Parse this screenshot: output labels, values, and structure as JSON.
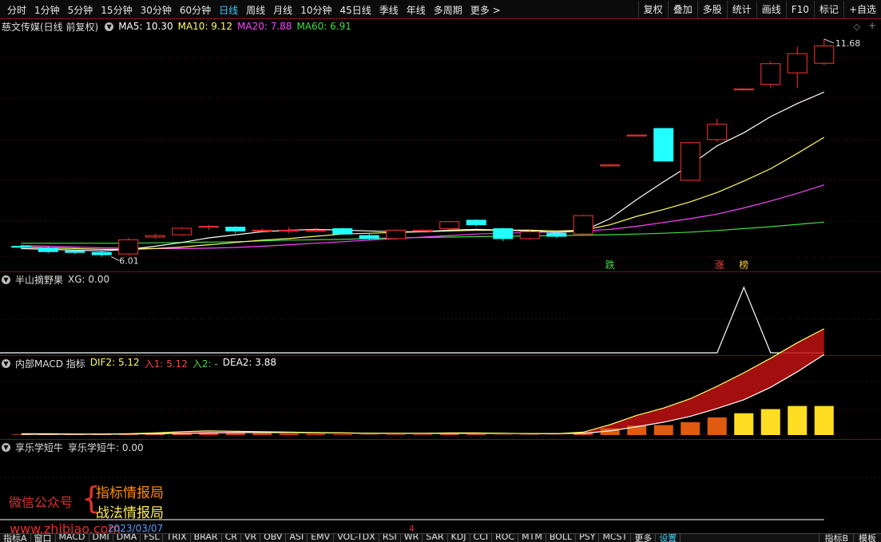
{
  "toolbar": {
    "periods": [
      "分时",
      "1分钟",
      "5分钟",
      "15分钟",
      "30分钟",
      "60分钟",
      "日线",
      "周线",
      "月线",
      "10分钟",
      "45日线",
      "季线",
      "年线",
      "多周期",
      "更多 >"
    ],
    "active": "日线",
    "right_buttons": [
      "复权",
      "叠加",
      "多股",
      "统计",
      "画线",
      "F10",
      "标记",
      "+自选"
    ]
  },
  "main_panel": {
    "title": "慈文传媒(日线 前复权)",
    "ma": [
      {
        "label": "MA5: 10.30",
        "color": "#ffffff"
      },
      {
        "label": "MA10: 9.12",
        "color": "#ffff66"
      },
      {
        "label": "MA20: 7.88",
        "color": "#ff44ff"
      },
      {
        "label": "MA60: 6.91",
        "color": "#44dd44"
      }
    ],
    "high_label": "11.68",
    "low_label": "6.01",
    "markers": [
      {
        "text": "跌",
        "color": "#44dd44"
      },
      {
        "text": "涨",
        "color": "#ff4444"
      },
      {
        "text": "榜",
        "color": "#ffcc33"
      }
    ]
  },
  "panel2": {
    "title": "半山摘野果",
    "value": "XG: 0.00"
  },
  "panel3": {
    "title": "内部MACD 指标",
    "items": [
      {
        "label": "DIF2: 5.12",
        "color": "#ffff66"
      },
      {
        "label": "入1: 5.12",
        "color": "#ff4444"
      },
      {
        "label": "入2: -",
        "color": "#44dd44"
      },
      {
        "label": "DEA2: 3.88",
        "color": "#ffffff"
      }
    ]
  },
  "panel4": {
    "title": "享乐学短牛",
    "value": "享乐学短牛: 0.00"
  },
  "watermark": {
    "label": "微信公众号",
    "line1": "指标情报局",
    "line2": "战法情报局",
    "url": "www.zhibiao.com",
    "date": "2023/03/07"
  },
  "mid_number": "4",
  "bottom_tabs": [
    "指标A",
    "窗口",
    "MACD",
    "DMI",
    "DMA",
    "FSL",
    "TRIX",
    "BRAR",
    "CR",
    "VR",
    "OBV",
    "ASI",
    "EMV",
    "VOL-TDX",
    "RSI",
    "WR",
    "SAR",
    "KDJ",
    "CCI",
    "ROC",
    "MTM",
    "BOLL",
    "PSY",
    "MCST",
    "更多",
    "设置"
  ],
  "bottom_active": "设置",
  "bottom_right": [
    "指标B",
    "模板"
  ],
  "chart_data": {
    "type": "candlestick",
    "candles": [
      {
        "o": 6.28,
        "h": 6.32,
        "l": 6.2,
        "c": 6.26
      },
      {
        "o": 6.24,
        "h": 6.28,
        "l": 6.1,
        "c": 6.14
      },
      {
        "o": 6.16,
        "h": 6.2,
        "l": 6.08,
        "c": 6.12
      },
      {
        "o": 6.12,
        "h": 6.16,
        "l": 6.01,
        "c": 6.06
      },
      {
        "o": 6.08,
        "h": 6.5,
        "l": 6.05,
        "c": 6.45
      },
      {
        "o": 6.52,
        "h": 6.6,
        "l": 6.48,
        "c": 6.56
      },
      {
        "o": 6.58,
        "h": 6.78,
        "l": 6.55,
        "c": 6.75
      },
      {
        "o": 6.78,
        "h": 6.84,
        "l": 6.7,
        "c": 6.8
      },
      {
        "o": 6.78,
        "h": 6.8,
        "l": 6.62,
        "c": 6.68
      },
      {
        "o": 6.7,
        "h": 6.74,
        "l": 6.66,
        "c": 6.7
      },
      {
        "o": 6.7,
        "h": 6.78,
        "l": 6.62,
        "c": 6.7
      },
      {
        "o": 6.7,
        "h": 6.75,
        "l": 6.65,
        "c": 6.7
      },
      {
        "o": 6.74,
        "h": 6.76,
        "l": 6.58,
        "c": 6.6
      },
      {
        "o": 6.56,
        "h": 6.6,
        "l": 6.44,
        "c": 6.48
      },
      {
        "o": 6.48,
        "h": 6.72,
        "l": 6.45,
        "c": 6.7
      },
      {
        "o": 6.7,
        "h": 6.72,
        "l": 6.65,
        "c": 6.7
      },
      {
        "o": 6.74,
        "h": 6.94,
        "l": 6.7,
        "c": 6.92
      },
      {
        "o": 6.96,
        "h": 6.98,
        "l": 6.8,
        "c": 6.84
      },
      {
        "o": 6.74,
        "h": 6.76,
        "l": 6.42,
        "c": 6.48
      },
      {
        "o": 6.48,
        "h": 6.7,
        "l": 6.44,
        "c": 6.66
      },
      {
        "o": 6.62,
        "h": 6.66,
        "l": 6.5,
        "c": 6.54
      },
      {
        "o": 6.6,
        "h": 7.1,
        "l": 6.58,
        "c": 7.08
      },
      {
        "o": 8.4,
        "h": 8.42,
        "l": 8.38,
        "c": 8.4
      },
      {
        "o": 9.18,
        "h": 9.2,
        "l": 9.16,
        "c": 9.18
      },
      {
        "o": 9.35,
        "h": 9.36,
        "l": 8.5,
        "c": 8.5
      },
      {
        "o": 8.0,
        "h": 9.0,
        "l": 8.0,
        "c": 8.98
      },
      {
        "o": 9.06,
        "h": 9.6,
        "l": 9.0,
        "c": 9.46
      },
      {
        "o": 10.38,
        "h": 10.4,
        "l": 10.36,
        "c": 10.38
      },
      {
        "o": 10.5,
        "h": 11.1,
        "l": 10.4,
        "c": 11.04
      },
      {
        "o": 10.8,
        "h": 11.48,
        "l": 10.4,
        "c": 11.3
      },
      {
        "o": 11.05,
        "h": 11.68,
        "l": 11.0,
        "c": 11.5
      }
    ],
    "ma5": [
      6.22,
      6.2,
      6.18,
      6.16,
      6.2,
      6.28,
      6.38,
      6.5,
      6.58,
      6.66,
      6.7,
      6.72,
      6.7,
      6.68,
      6.66,
      6.66,
      6.7,
      6.72,
      6.7,
      6.68,
      6.64,
      6.68,
      7.0,
      7.5,
      7.96,
      8.4,
      8.9,
      9.24,
      9.66,
      10.0,
      10.3
    ],
    "ma10": [
      6.26,
      6.24,
      6.22,
      6.2,
      6.2,
      6.22,
      6.26,
      6.32,
      6.38,
      6.44,
      6.48,
      6.54,
      6.6,
      6.62,
      6.64,
      6.66,
      6.68,
      6.7,
      6.7,
      6.7,
      6.68,
      6.7,
      6.84,
      7.06,
      7.24,
      7.44,
      7.68,
      7.98,
      8.3,
      8.7,
      9.12
    ],
    "ma20": [
      6.3,
      6.28,
      6.26,
      6.24,
      6.23,
      6.22,
      6.22,
      6.23,
      6.25,
      6.28,
      6.32,
      6.36,
      6.4,
      6.44,
      6.48,
      6.52,
      6.56,
      6.6,
      6.62,
      6.64,
      6.66,
      6.68,
      6.72,
      6.8,
      6.9,
      7.0,
      7.12,
      7.28,
      7.46,
      7.66,
      7.88
    ],
    "ma60": [
      6.36,
      6.36,
      6.36,
      6.36,
      6.36,
      6.37,
      6.38,
      6.39,
      6.4,
      6.42,
      6.44,
      6.45,
      6.46,
      6.48,
      6.5,
      6.51,
      6.52,
      6.53,
      6.54,
      6.55,
      6.56,
      6.57,
      6.58,
      6.6,
      6.62,
      6.65,
      6.69,
      6.74,
      6.79,
      6.85,
      6.91
    ],
    "xg": [
      0,
      0,
      0,
      0,
      0,
      0,
      0,
      0,
      0,
      0,
      0,
      0,
      0,
      0,
      0,
      0,
      0,
      0,
      0,
      0,
      0,
      0,
      0,
      0,
      0,
      0,
      0,
      1,
      0,
      0,
      0
    ],
    "macd_hist": [
      0.03,
      0.04,
      0.04,
      0.03,
      0.05,
      0.09,
      0.12,
      0.13,
      0.1,
      0.09,
      0.07,
      0.06,
      0.04,
      0.02,
      0.03,
      0.03,
      0.05,
      0.04,
      0.02,
      0.02,
      0.01,
      0.12,
      0.32,
      0.45,
      0.48,
      0.62,
      0.85,
      1.05,
      1.25,
      1.4,
      1.4
    ],
    "dif2": [
      0.06,
      0.06,
      0.05,
      0.05,
      0.06,
      0.1,
      0.16,
      0.2,
      0.18,
      0.16,
      0.14,
      0.12,
      0.1,
      0.08,
      0.08,
      0.08,
      0.1,
      0.1,
      0.08,
      0.07,
      0.06,
      0.14,
      0.5,
      0.95,
      1.3,
      1.75,
      2.35,
      3.0,
      3.7,
      4.45,
      5.12
    ],
    "dea2": [
      0.04,
      0.04,
      0.04,
      0.04,
      0.05,
      0.06,
      0.08,
      0.1,
      0.12,
      0.12,
      0.12,
      0.11,
      0.1,
      0.09,
      0.08,
      0.08,
      0.08,
      0.08,
      0.08,
      0.07,
      0.07,
      0.08,
      0.2,
      0.4,
      0.62,
      0.9,
      1.28,
      1.7,
      2.3,
      3.05,
      3.88
    ]
  }
}
